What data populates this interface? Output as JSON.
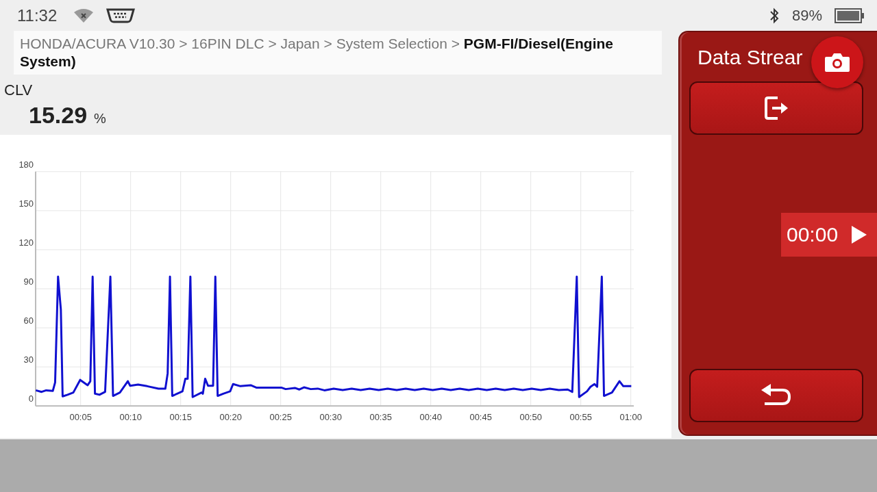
{
  "status_bar": {
    "time": "11:32",
    "battery": "89%"
  },
  "breadcrumb": {
    "text": "HONDA/ACURA V10.30 > 16PIN DLC > Japan > System Selection > **PGM-FI/Diesel(Engine System)**"
  },
  "reading": {
    "name": "CLV",
    "value": "15.29",
    "unit": "%"
  },
  "chart_data": {
    "type": "line",
    "grid": true,
    "xlim": [
      0.5,
      60.3
    ],
    "ylim": [
      0,
      180
    ],
    "yticks": [
      0,
      30,
      60,
      90,
      120,
      150,
      180
    ],
    "xticks": [
      {
        "value": 5,
        "label": "00:05"
      },
      {
        "value": 10,
        "label": "00:10"
      },
      {
        "value": 15,
        "label": "00:15"
      },
      {
        "value": 20,
        "label": "00:20"
      },
      {
        "value": 25,
        "label": "00:25"
      },
      {
        "value": 30,
        "label": "00:30"
      },
      {
        "value": 35,
        "label": "00:35"
      },
      {
        "value": 40,
        "label": "00:40"
      },
      {
        "value": 45,
        "label": "00:45"
      },
      {
        "value": 50,
        "label": "00:50"
      },
      {
        "value": 55,
        "label": "00:55"
      },
      {
        "value": 60,
        "label": "01:00"
      }
    ],
    "x": [
      0.52,
      1.1,
      1.56,
      2.22,
      2.45,
      2.74,
      3.02,
      3.2,
      3.7,
      4.27,
      4.95,
      5.7,
      5.97,
      6.2,
      6.43,
      6.88,
      7.45,
      7.97,
      8.24,
      8.93,
      9.72,
      9.95,
      10.74,
      11.65,
      12.79,
      13.47,
      13.7,
      13.93,
      14.16,
      15.18,
      15.47,
      15.7,
      15.97,
      16.2,
      17.1,
      17.22,
      17.45,
      17.74,
      18.24,
      18.47,
      18.7,
      19.26,
      19.95,
      20.24,
      20.97,
      22.0,
      22.56,
      25.06,
      25.5,
      26.42,
      26.87,
      27.33,
      28.0,
      28.7,
      29.37,
      30.3,
      31.2,
      32.1,
      33.0,
      33.9,
      34.8,
      35.7,
      36.6,
      37.5,
      38.4,
      39.3,
      40.2,
      41.1,
      42.0,
      42.9,
      43.8,
      44.7,
      45.6,
      46.5,
      47.4,
      48.3,
      49.2,
      50.1,
      51.0,
      51.9,
      52.8,
      53.7,
      54.15,
      54.6,
      54.83,
      55.62,
      55.97,
      56.37,
      56.64,
      57.1,
      57.32,
      58.12,
      58.87,
      59.25,
      60.05
    ],
    "series": [
      {
        "color": "#1010d0",
        "values": [
          12,
          10.8,
          12,
          11.5,
          18,
          99.3,
          74,
          7.3,
          8.6,
          10.3,
          20,
          15.9,
          19,
          99.3,
          9.4,
          8.6,
          10.8,
          99.3,
          7.7,
          10.3,
          19,
          15.5,
          16.4,
          15.2,
          13.3,
          13.3,
          25,
          99.3,
          7.7,
          11.2,
          20.8,
          20.8,
          99.3,
          6.8,
          10.3,
          9.4,
          20.8,
          15.5,
          15.5,
          99.3,
          7.7,
          9.4,
          11.2,
          16.8,
          15.2,
          15.9,
          14.1,
          14.1,
          12.9,
          13.8,
          12.6,
          14.3,
          12.9,
          13.3,
          12,
          13.3,
          12.2,
          13.3,
          12.2,
          13.3,
          12.2,
          13.3,
          12.2,
          13.3,
          12.2,
          13.3,
          12.2,
          13.3,
          12.2,
          13.3,
          12.2,
          13.3,
          12.2,
          13.3,
          12.2,
          13.3,
          12.2,
          13.3,
          12.2,
          13.3,
          12.2,
          12.6,
          10.8,
          99.3,
          6.8,
          11.2,
          14.7,
          16.8,
          14.7,
          99.3,
          7.7,
          10.3,
          19,
          15.2,
          15.2
        ]
      }
    ]
  },
  "side_panel": {
    "title": "Data Strear",
    "timer": "00:00"
  }
}
